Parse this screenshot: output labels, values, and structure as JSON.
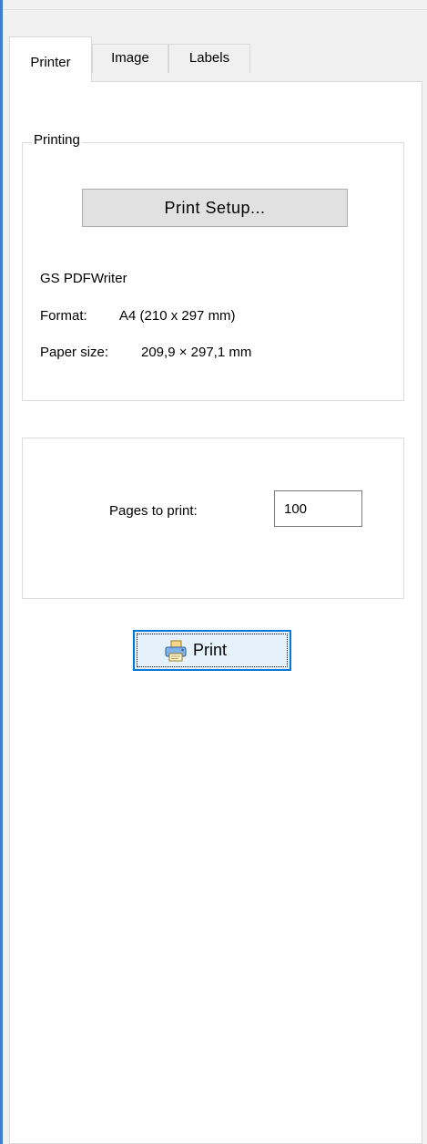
{
  "tabs": [
    {
      "label": "Printer",
      "active": true
    },
    {
      "label": "Image",
      "active": false
    },
    {
      "label": "Labels",
      "active": false
    }
  ],
  "printing_group": {
    "title": "Printing",
    "setup_button": "Print Setup...",
    "printer_name": "GS PDFWriter",
    "format_label": "Format:",
    "format_value": "A4 (210 x 297 mm)",
    "paper_size_label": "Paper size:",
    "paper_size_value": "209,9 × 297,1  mm"
  },
  "pages": {
    "label": "Pages to print:",
    "value": "100"
  },
  "print_button": {
    "label": "Print",
    "icon": "printer-icon"
  },
  "colors": {
    "accent": "#0078d7",
    "panel": "#f0f0f0",
    "page": "#ffffff"
  }
}
